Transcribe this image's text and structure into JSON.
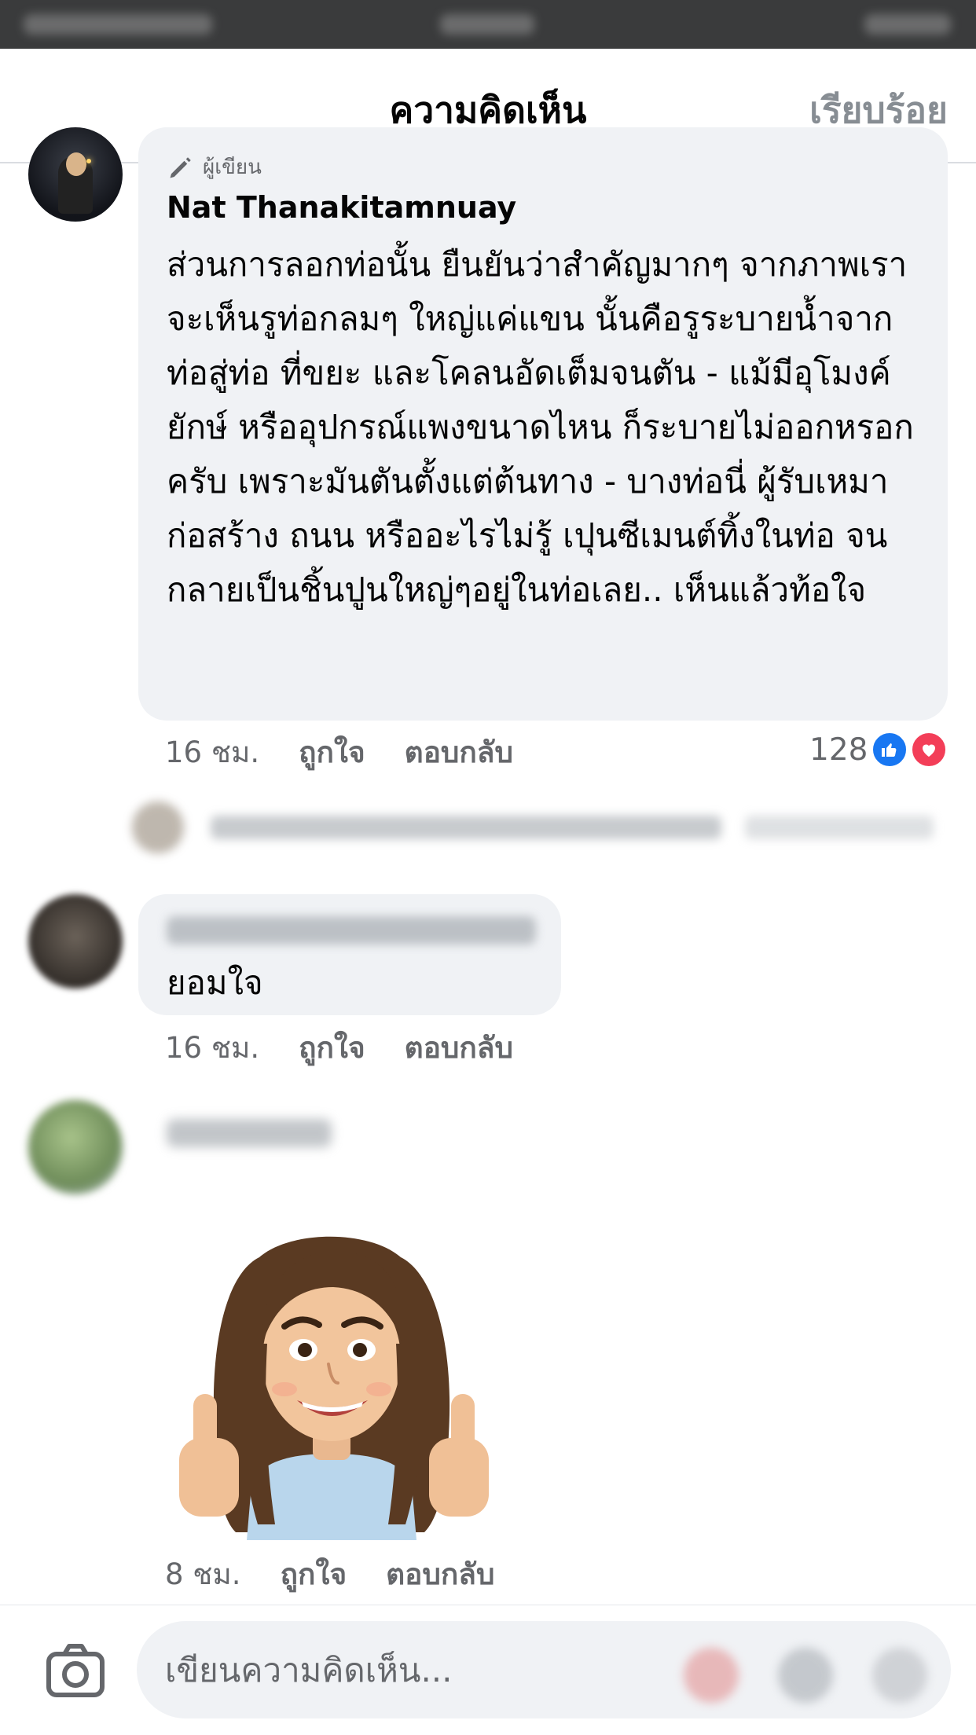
{
  "header": {
    "title": "ความคิดเห็น",
    "done_label": "เรียบร้อย"
  },
  "comments": [
    {
      "badge": "ผู้เขียน",
      "author": "Nat Thanakitamnuay",
      "text": "ส่วนการลอกท่อนั้น ยืนยันว่าสำคัญมากๆ จากภาพเราจะเห็นรูท่อกลมๆ ใหญ่แค่แขน นั้นคือรูระบายน้ำจากท่อสู่ท่อ ที่ขยะ และโคลนอัดเต็มจนตัน - แม้มีอุโมงค์ยักษ์ หรืออุปกรณ์แพงขนาดไหน ก็ระบายไม่ออกหรอกครับ เพราะมันตันตั้งแต่ต้นทาง - บางท่อนี่ ผู้รับเหมาก่อสร้าง ถนน หรืออะไรไม่รู้ เปุนซีเมนต์ทิ้งในท่อ จนกลายเป็นชิ้นปูนใหญ่ๆอยู่ในท่อเลย.. เห็นแล้วท้อใจ",
      "time": "16 ชม.",
      "like_label": "ถูกใจ",
      "reply_label": "ตอบกลับ",
      "reaction_count": "128"
    },
    {
      "text": "ยอมใจ",
      "time": "16 ชม.",
      "like_label": "ถูกใจ",
      "reply_label": "ตอบกลับ"
    },
    {
      "time": "8 ชม.",
      "like_label": "ถูกใจ",
      "reply_label": "ตอบกลับ"
    }
  ],
  "composer": {
    "placeholder": "เขียนความคิดเห็น..."
  },
  "colors": {
    "bubble": "#f0f2f5",
    "meta_text": "#65676b",
    "like_blue": "#1877f2",
    "love_red": "#f33e58"
  }
}
